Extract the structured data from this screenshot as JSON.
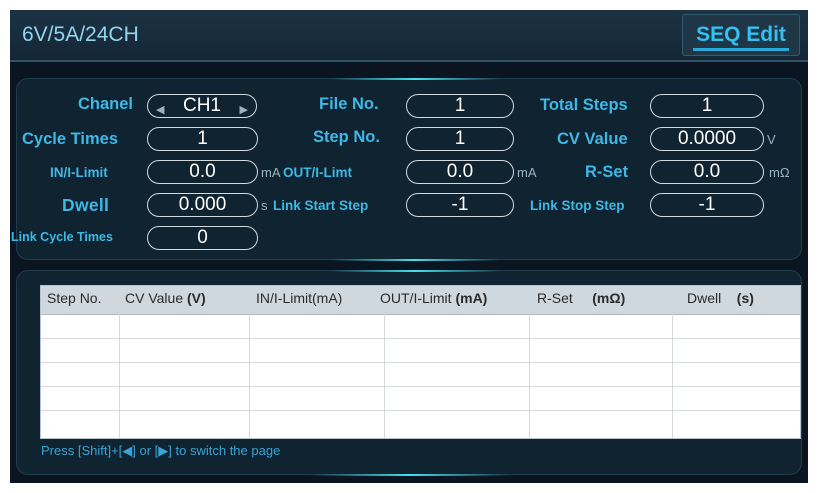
{
  "header": {
    "title": "6V/5A/24CH",
    "mode_tab": "SEQ Edit"
  },
  "settings": {
    "channel": {
      "label": "Chanel",
      "value": "CH1"
    },
    "file_no": {
      "label": "File No.",
      "value": "1"
    },
    "total_steps": {
      "label": "Total Steps",
      "value": "1"
    },
    "cycle_times": {
      "label": "Cycle Times",
      "value": "1"
    },
    "step_no": {
      "label": "Step No.",
      "value": "1"
    },
    "cv_value": {
      "label": "CV Value",
      "value": "0.0000",
      "unit": "V"
    },
    "in_limit": {
      "label": "IN/I-Limit",
      "value": "0.0",
      "unit": "mA"
    },
    "out_limit": {
      "label": "OUT/I-Limt",
      "value": "0.0",
      "unit": "mA"
    },
    "r_set": {
      "label": "R-Set",
      "value": "0.0",
      "unit": "mΩ"
    },
    "dwell": {
      "label": "Dwell",
      "value": "0.000",
      "unit": "s"
    },
    "link_start_step": {
      "label": "Link Start Step",
      "value": "-1"
    },
    "link_stop_step": {
      "label": "Link Stop Step",
      "value": "-1"
    },
    "link_cycle_times": {
      "label": "Link Cycle Times",
      "value": "0"
    }
  },
  "table": {
    "columns": [
      {
        "name": "Step No.",
        "unit": ""
      },
      {
        "name": "CV Value",
        "unit": "(V)"
      },
      {
        "name": "IN/I-Limit(mA)",
        "unit": ""
      },
      {
        "name": "OUT/I-Limit",
        "unit": "(mA)"
      },
      {
        "name": "R-Set",
        "unit": "(mΩ)"
      },
      {
        "name": "Dwell",
        "unit": "(s)"
      }
    ],
    "rows": [
      [
        "",
        "",
        "",
        "",
        "",
        ""
      ],
      [
        "",
        "",
        "",
        "",
        "",
        ""
      ],
      [
        "",
        "",
        "",
        "",
        "",
        ""
      ],
      [
        "",
        "",
        "",
        "",
        "",
        ""
      ],
      [
        "",
        "",
        "",
        "",
        "",
        ""
      ]
    ]
  },
  "footer": {
    "hint": "Press [Shift]+[◀] or [▶] to switch the page"
  },
  "colors": {
    "background": "#0b1522",
    "label": "#3fb8e6",
    "title": "#8fd6ee",
    "value": "#ffffff",
    "accent": "#34c0f0"
  }
}
